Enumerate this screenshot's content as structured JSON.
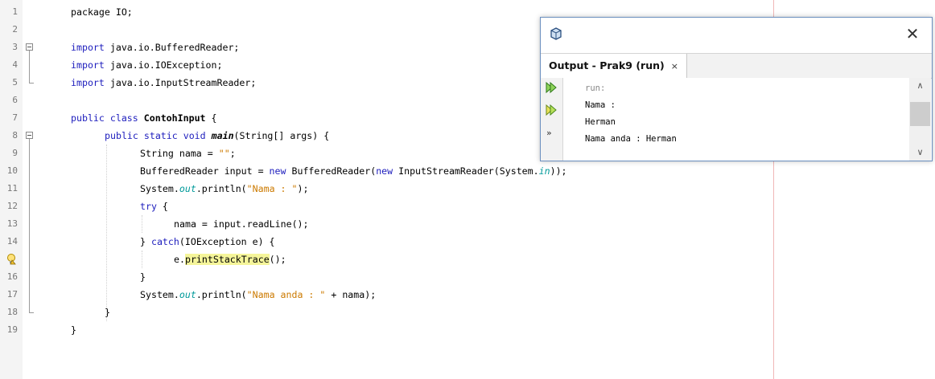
{
  "editor": {
    "line_numbers": [
      "1",
      "2",
      "3",
      "4",
      "5",
      "6",
      "7",
      "8",
      "9",
      "10",
      "11",
      "12",
      "13",
      "14",
      "15",
      "16",
      "17",
      "18",
      "19"
    ],
    "lines": [
      {
        "parts": [
          {
            "t": "package IO;",
            "c": ""
          }
        ]
      },
      {
        "parts": []
      },
      {
        "parts": [
          {
            "t": "import",
            "c": "kw"
          },
          {
            "t": " java.io.BufferedReader;",
            "c": ""
          }
        ]
      },
      {
        "parts": [
          {
            "t": "import",
            "c": "kw"
          },
          {
            "t": " java.io.IOException;",
            "c": ""
          }
        ]
      },
      {
        "parts": [
          {
            "t": "import",
            "c": "kw"
          },
          {
            "t": " java.io.InputStreamReader;",
            "c": ""
          }
        ]
      },
      {
        "parts": []
      },
      {
        "parts": [
          {
            "t": "public class",
            "c": "kw"
          },
          {
            "t": " ",
            "c": ""
          },
          {
            "t": "ContohInput",
            "c": "cls"
          },
          {
            "t": " {",
            "c": ""
          }
        ]
      },
      {
        "parts": [
          {
            "t": "public static void",
            "c": "kw"
          },
          {
            "t": " ",
            "c": ""
          },
          {
            "t": "main",
            "c": "meth"
          },
          {
            "t": "(String[] args) {",
            "c": ""
          }
        ]
      },
      {
        "parts": [
          {
            "t": "String nama = ",
            "c": ""
          },
          {
            "t": "\"\"",
            "c": "str"
          },
          {
            "t": ";",
            "c": ""
          }
        ]
      },
      {
        "parts": [
          {
            "t": "BufferedReader input = ",
            "c": ""
          },
          {
            "t": "new",
            "c": "kw"
          },
          {
            "t": " BufferedReader(",
            "c": ""
          },
          {
            "t": "new",
            "c": "kw"
          },
          {
            "t": " InputStreamReader(System.",
            "c": ""
          },
          {
            "t": "in",
            "c": "fld"
          },
          {
            "t": "));",
            "c": ""
          }
        ]
      },
      {
        "parts": [
          {
            "t": "System.",
            "c": ""
          },
          {
            "t": "out",
            "c": "fld"
          },
          {
            "t": ".println(",
            "c": ""
          },
          {
            "t": "\"Nama : \"",
            "c": "str"
          },
          {
            "t": ");",
            "c": ""
          }
        ]
      },
      {
        "parts": [
          {
            "t": "try",
            "c": "kw"
          },
          {
            "t": " {",
            "c": ""
          }
        ]
      },
      {
        "parts": [
          {
            "t": "nama = input.readLine();",
            "c": ""
          }
        ]
      },
      {
        "parts": [
          {
            "t": "} ",
            "c": ""
          },
          {
            "t": "catch",
            "c": "kw"
          },
          {
            "t": "(IOException e) {",
            "c": ""
          }
        ]
      },
      {
        "parts": [
          {
            "t": "e.",
            "c": ""
          },
          {
            "t": "printStackTrace",
            "c": "hl"
          },
          {
            "t": "();",
            "c": ""
          }
        ]
      },
      {
        "parts": [
          {
            "t": "}",
            "c": ""
          }
        ]
      },
      {
        "parts": [
          {
            "t": "System.",
            "c": ""
          },
          {
            "t": "out",
            "c": "fld"
          },
          {
            "t": ".println(",
            "c": ""
          },
          {
            "t": "\"Nama anda : \"",
            "c": "str"
          },
          {
            "t": " + nama);",
            "c": ""
          }
        ]
      },
      {
        "parts": [
          {
            "t": "}",
            "c": ""
          }
        ]
      },
      {
        "parts": [
          {
            "t": "}",
            "c": ""
          }
        ]
      }
    ]
  },
  "output_window": {
    "tab_title": "Output - Prak9 (run)",
    "tab_close": "×",
    "close_glyph": "✕",
    "more_glyph": "»",
    "scroll_up_glyph": "∧",
    "scroll_down_glyph": "∨",
    "lines": [
      "run:",
      "Nama :",
      "Herman",
      "Nama anda : Herman"
    ],
    "line_colors": [
      "#888888",
      "#000000",
      "#000000",
      "#000000"
    ]
  }
}
